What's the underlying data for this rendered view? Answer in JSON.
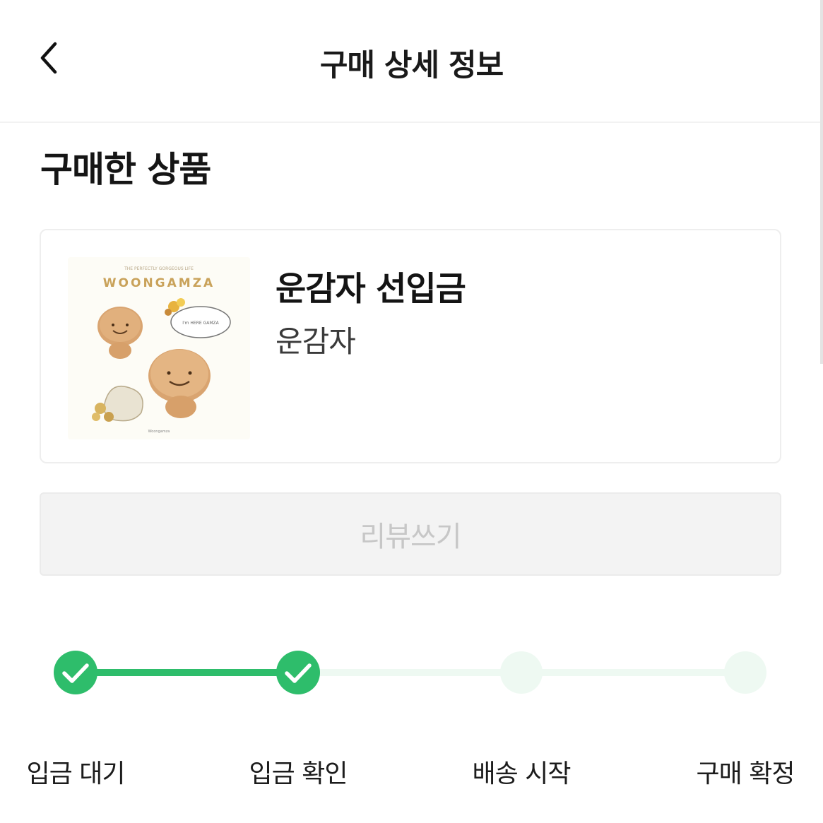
{
  "header": {
    "title": "구매 상세 정보",
    "back_icon": "chevron-left-icon"
  },
  "section": {
    "title": "구매한 상품"
  },
  "product": {
    "name": "운감자 선입금",
    "seller": "운감자",
    "thumbnail": {
      "subtitle": "THE PERFECTLY GORGEOUS LIFE",
      "wordmark": "WOONGAMZA",
      "bubble": "I'm HERE GAMZA",
      "brand": "Woongamza"
    }
  },
  "review_button": {
    "label": "리뷰쓰기"
  },
  "progress": {
    "steps": [
      {
        "label": "입금 대기",
        "done": true
      },
      {
        "label": "입금 확인",
        "done": true
      },
      {
        "label": "배송 시작",
        "done": false
      },
      {
        "label": "구매 확정",
        "done": false
      }
    ],
    "colors": {
      "done": "#2ebd6b",
      "pending": "#eef9f2",
      "check": "#ffffff"
    }
  }
}
